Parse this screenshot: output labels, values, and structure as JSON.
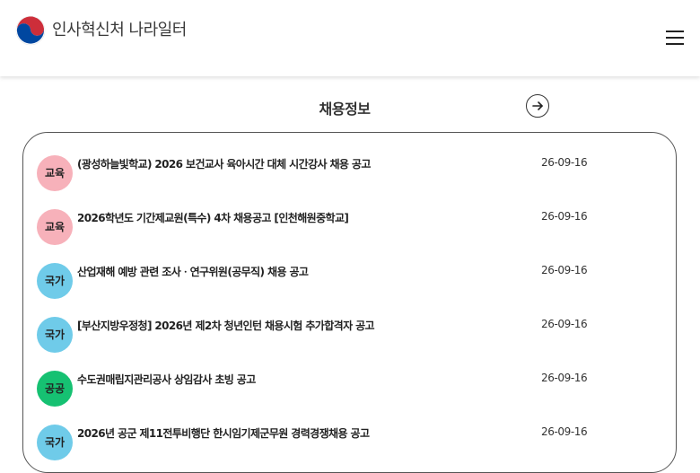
{
  "header": {
    "logo_text": "인사혁신처 나라일터",
    "emblem_colors": {
      "top": "#cd2e3a",
      "bottom": "#0047a0"
    }
  },
  "section": {
    "title": "채용정보",
    "more_icon": "arrow-right-icon"
  },
  "category_colors": {
    "교육": "#f7b1ba",
    "국가": "#6fcbe9",
    "공공": "#16c172"
  },
  "jobs": [
    {
      "category": "교육",
      "title": "(광성하늘빛학교) 2026 보건교사 육아시간 대체 시간강사 채용 공고",
      "date": "26-09-16"
    },
    {
      "category": "교육",
      "title": "2026학년도 기간제교원(특수) 4차 채용공고 [인천해원중학교]",
      "date": "26-09-16"
    },
    {
      "category": "국가",
      "title": "산업재해 예방 관련 조사ㆍ연구위원(공무직) 채용 공고",
      "date": "26-09-16"
    },
    {
      "category": "국가",
      "title": "[부산지방우정청] 2026년 제2차 청년인턴 채용시험 추가합격자 공고",
      "date": "26-09-16"
    },
    {
      "category": "공공",
      "title": "수도권매립지관리공사 상임감사 초빙 공고",
      "date": "26-09-16"
    },
    {
      "category": "국가",
      "title": "2026년 공군 제11전투비행단 한시임기제군무원 경력경쟁채용 공고",
      "date": "26-09-16"
    }
  ]
}
